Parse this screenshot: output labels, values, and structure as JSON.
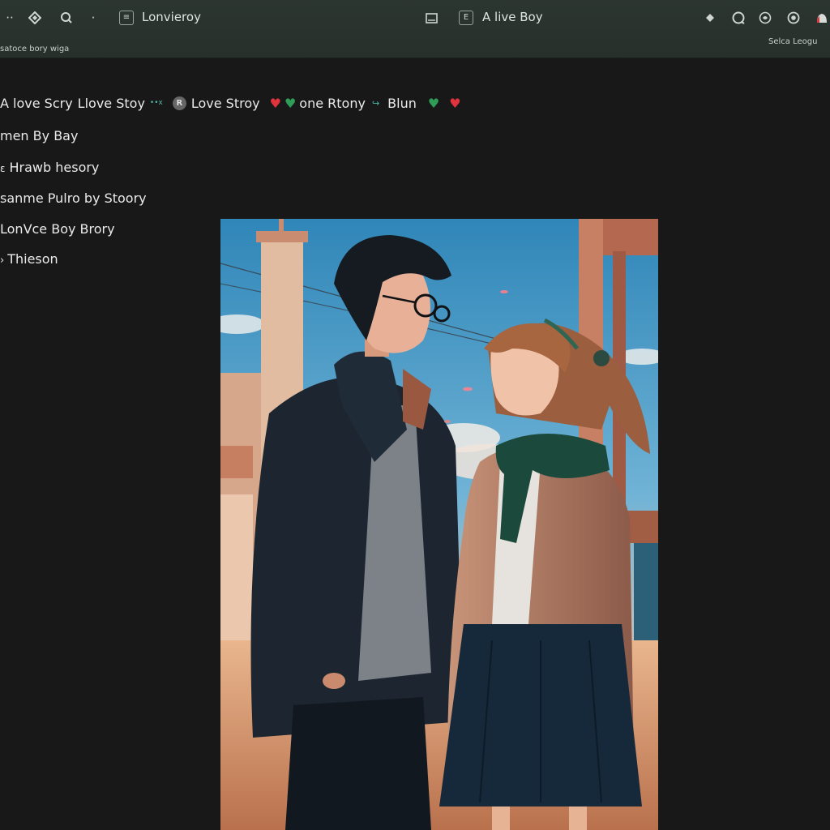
{
  "topbar": {
    "app_title": "Lonvieroy",
    "sub_label": "satoce bory wiga",
    "center_title": "A live Boy",
    "right_label": "Selca Leogu",
    "center_badge": "E"
  },
  "feed": {
    "text_1": "A love Scry",
    "text_2": "Llove Stoy",
    "tag": "••x",
    "avatar_letter": "R",
    "text_3": "Love Stroy",
    "text_4": "one Rtony",
    "text_5": "Blun"
  },
  "list": [
    "men By Bay",
    "Hrawb hesory",
    "sanme Pulro by Stoory",
    "LonVce Boy Brory",
    "Thieson"
  ],
  "colors": {
    "topbar": "#27302b",
    "background": "#181818",
    "heart_red": "#e0333b",
    "heart_green": "#2f9d58",
    "accent": "#4fb7a6"
  },
  "icons": [
    "dots-icon",
    "diamond-icon",
    "search-icon",
    "dot-icon",
    "document-icon",
    "picture-icon",
    "badge-icon",
    "pin-icon",
    "refresh-icon",
    "mention-icon",
    "record-icon",
    "notification-icon"
  ]
}
